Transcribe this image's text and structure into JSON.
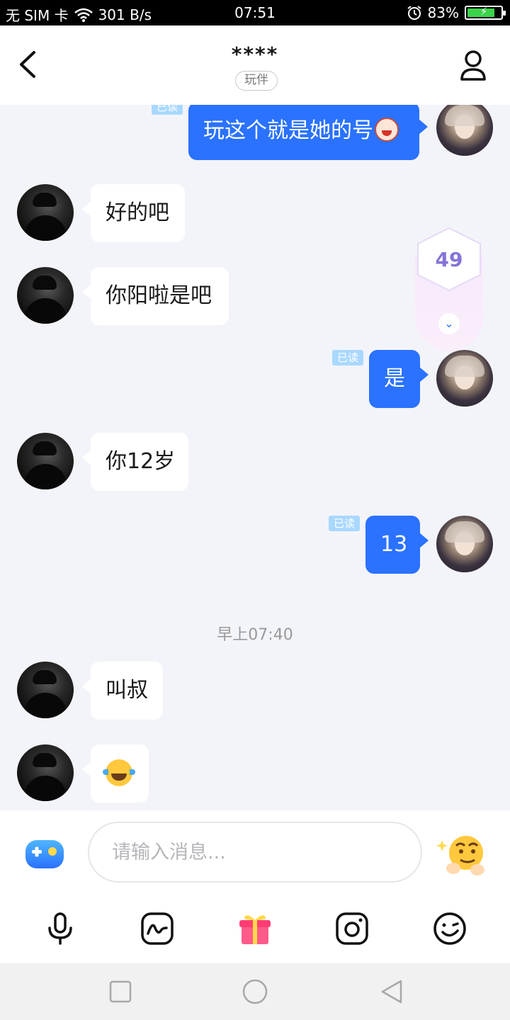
{
  "status_bar": {
    "carrier": "无 SIM 卡",
    "speed": "301 B/s",
    "time": "07:51",
    "battery": "83%",
    "battery_level": 0.83
  },
  "header": {
    "title": "****",
    "tag": "玩伴",
    "icons": [
      "back-arrow-icon",
      "user-profile-icon"
    ]
  },
  "messages": {
    "m1": {
      "text": "玩这个就是她的号",
      "read": "已读",
      "emoji": "cake-face-emoji"
    },
    "m2": {
      "text": "好的吧"
    },
    "m3": {
      "text": "你阳啦是吧"
    },
    "m4": {
      "text": "是",
      "read": "已读"
    },
    "m5": {
      "text": "你12岁"
    },
    "m6": {
      "text": "13",
      "read": "已读"
    },
    "time_divider": "早上07:40",
    "m7": {
      "text": "叫叔"
    },
    "m8": {
      "emoji": "tears-of-joy-emoji"
    }
  },
  "unread": {
    "count": "49"
  },
  "input": {
    "placeholder": "请输入消息...",
    "value": ""
  },
  "toolbar": {
    "icons": [
      "microphone-icon",
      "doodle-icon",
      "gift-icon",
      "camera-icon",
      "emoji-icon"
    ]
  },
  "colors": {
    "accent": "#2a72ff",
    "read_badge": "#a9d8ff",
    "background": "#f3f4f9"
  }
}
